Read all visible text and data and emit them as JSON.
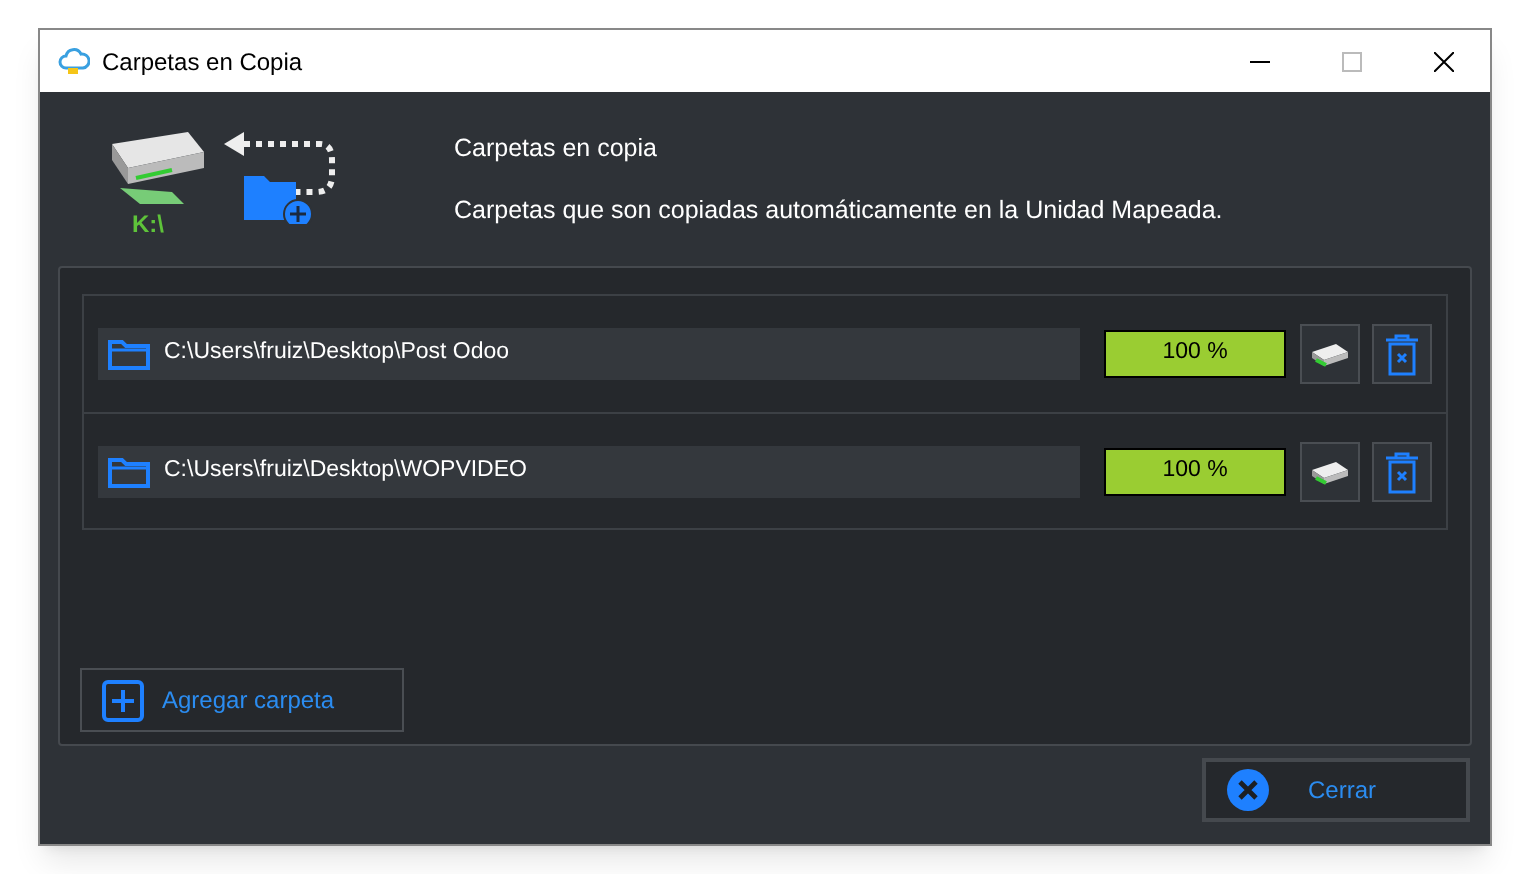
{
  "window": {
    "title": "Carpetas en Copia"
  },
  "header": {
    "drive_label": "K:\\",
    "title": "Carpetas en copia",
    "description": "Carpetas que son copiadas automáticamente en la Unidad Mapeada."
  },
  "folders": [
    {
      "path": "C:\\Users\\fruiz\\Desktop\\Post Odoo",
      "level": 1,
      "reading": "100 %"
    },
    {
      "path": "C:\\Users\\fruiz\\Desktop\\WOPVIDEO",
      "level": 1,
      "reading": "100 %"
    }
  ],
  "add_button": "Agregar carpeta",
  "close_button": "Cerrar"
}
